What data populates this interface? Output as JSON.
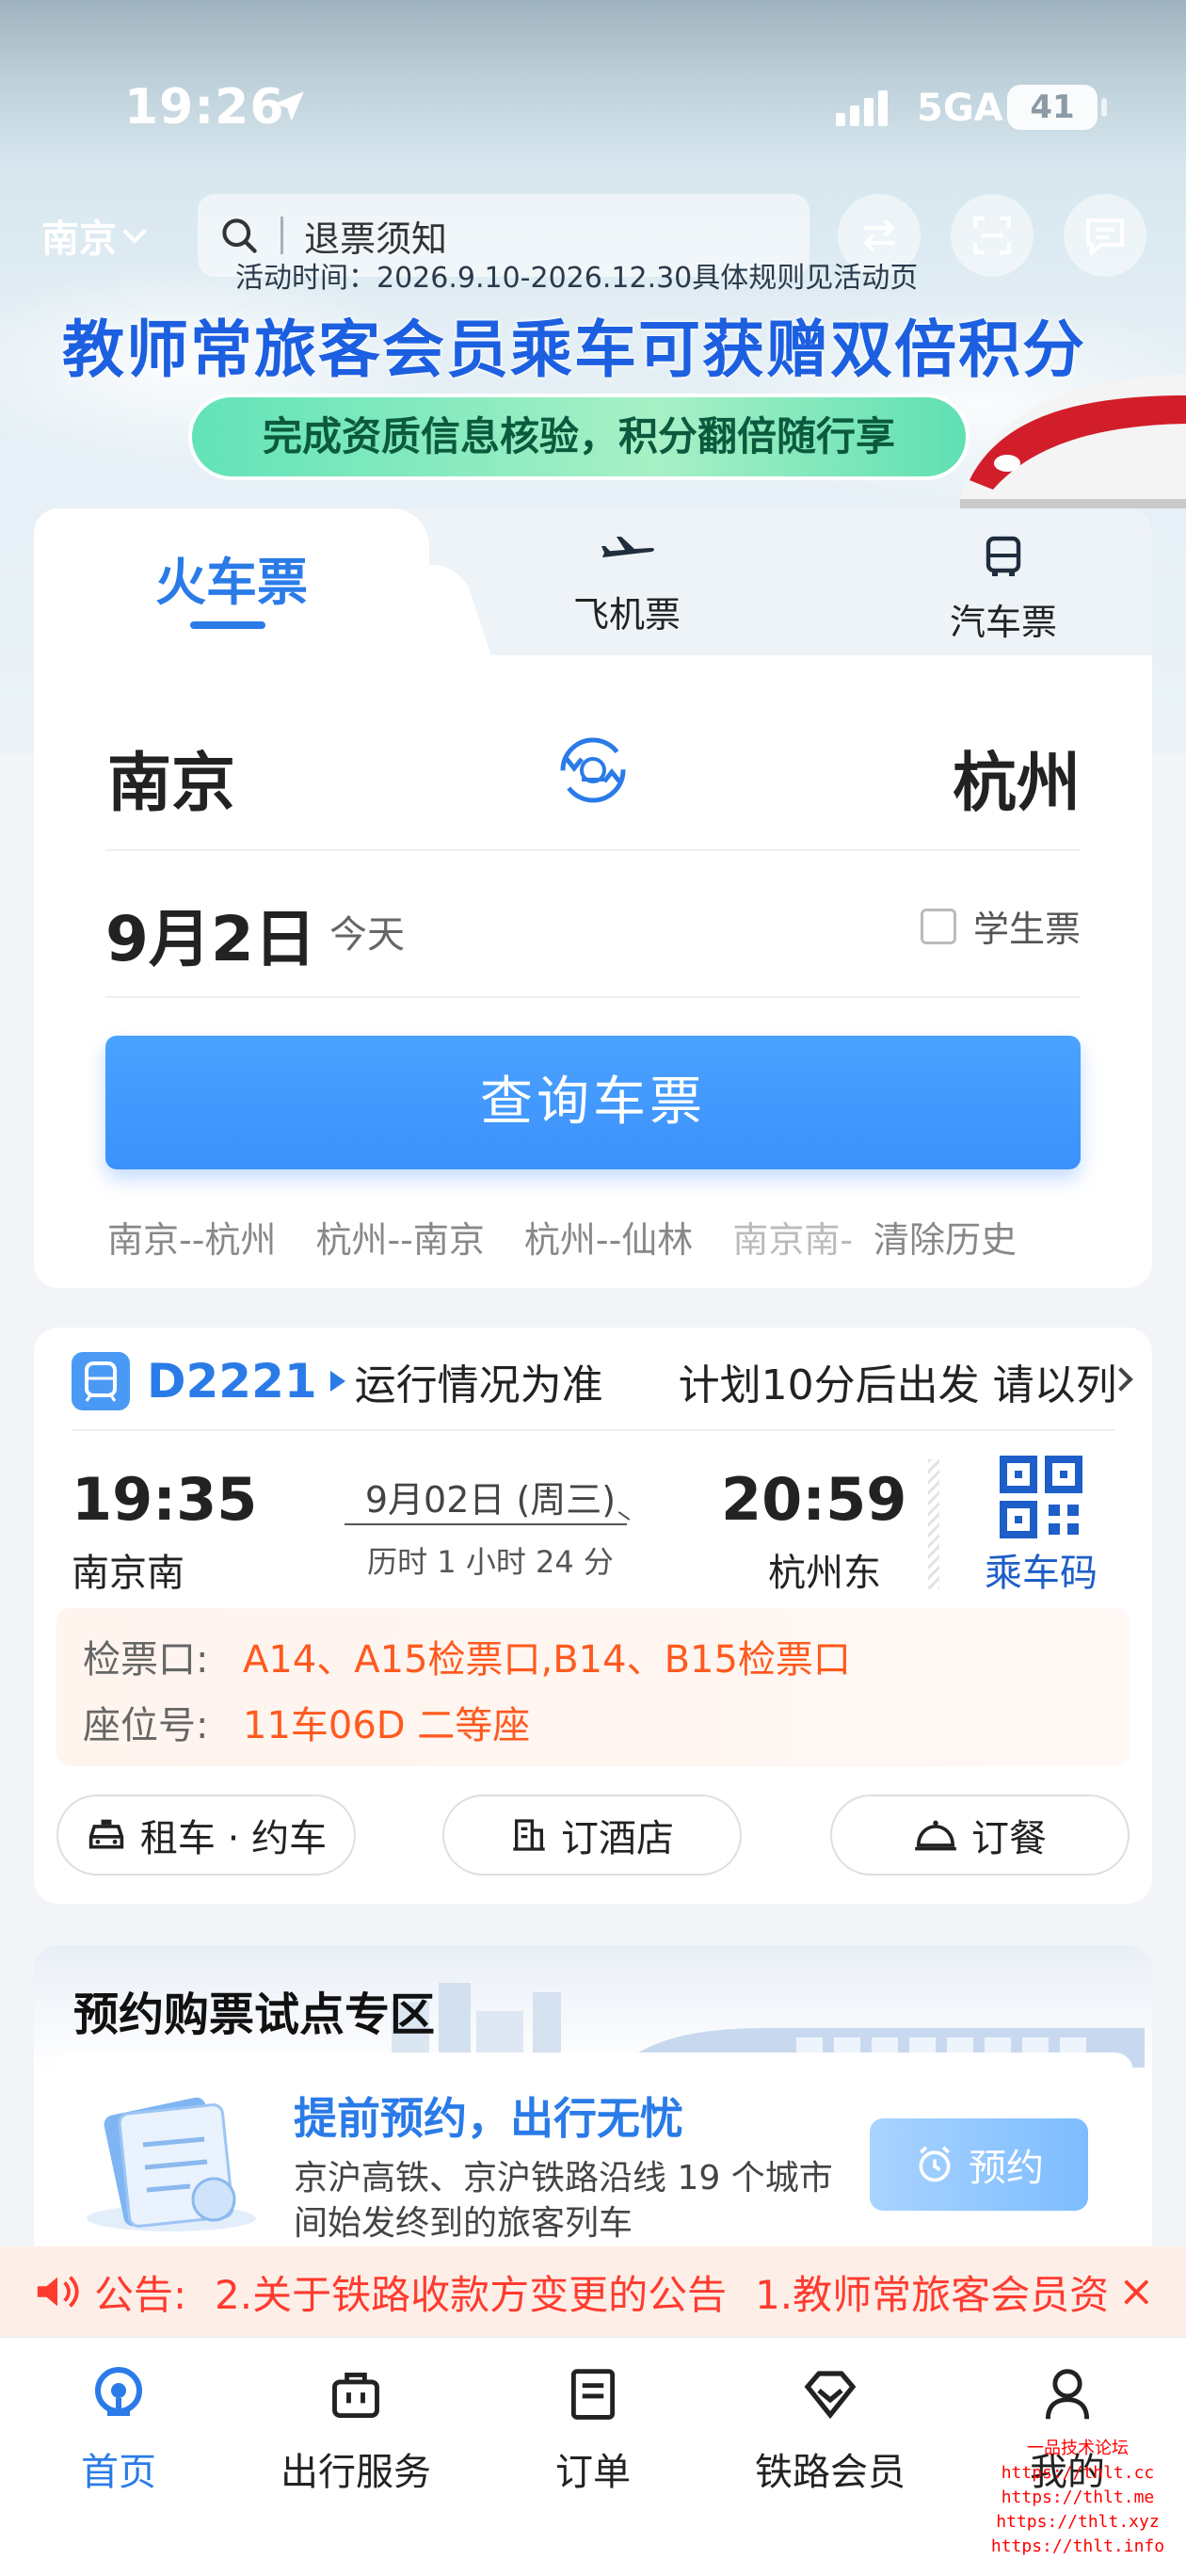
{
  "status_bar": {
    "time": "19:26",
    "network": "5GA",
    "battery": "41"
  },
  "header": {
    "city": "南京",
    "search_placeholder": "退票须知"
  },
  "banner": {
    "note": "活动时间：2026.9.10-2026.12.30具体规则见活动页",
    "title": "教师常旅客会员乘车可获赠双倍积分",
    "pill": "完成资质信息核验，积分翻倍随行享"
  },
  "ticket": {
    "tabs": [
      "火车票",
      "飞机票",
      "汽车票"
    ],
    "from": "南京",
    "to": "杭州",
    "date": "9月2日",
    "date_note": "今天",
    "student_label": "学生票",
    "query_label": "查询车票",
    "history": [
      "南京--杭州",
      "杭州--南京",
      "杭州--仙林",
      "南京南-"
    ],
    "clear_history": "清除历史"
  },
  "trip": {
    "train_no": "D2221",
    "status": "运行情况为准",
    "notice": "计划10分后出发 请以列",
    "dep_time": "19:35",
    "dep_station": "南京南",
    "date": "9月02日 (周三)",
    "duration": "历时 1 小时 24 分",
    "arr_time": "20:59",
    "arr_station": "杭州东",
    "qr_label": "乘车码",
    "gate_key": "检票口:",
    "gate_val": "A14、A15检票口,B14、B15检票口",
    "seat_key": "座位号:",
    "seat_val": "11车06D 二等座",
    "actions": [
      "租车 · 约车",
      "订酒店",
      "订餐"
    ]
  },
  "reserve": {
    "title": "预约购票试点专区",
    "subtitle": "提前预约，出行无忧",
    "desc": "京沪高铁、京沪铁路沿线 19 个城市间始发终到的旅客列车",
    "button": "预约"
  },
  "notice": {
    "label": "公告:",
    "items": [
      "2.关于铁路收款方变更的公告",
      "1.教师常旅客会员资"
    ]
  },
  "bottom_nav": [
    {
      "label": "首页",
      "icon": "home-rail-icon"
    },
    {
      "label": "出行服务",
      "icon": "briefcase-icon"
    },
    {
      "label": "订单",
      "icon": "order-doc-icon"
    },
    {
      "label": "铁路会员",
      "icon": "diamond-icon"
    },
    {
      "label": "我的",
      "icon": "person-icon"
    }
  ],
  "watermark": [
    "一品技术论坛",
    "https://thlt.cc",
    "https://thlt.me",
    "https://thlt.xyz",
    "https://thlt.info"
  ],
  "colors": {
    "accent": "#2a7be8",
    "warning": "#ff5a1f",
    "notice": "#ff3b2f"
  }
}
